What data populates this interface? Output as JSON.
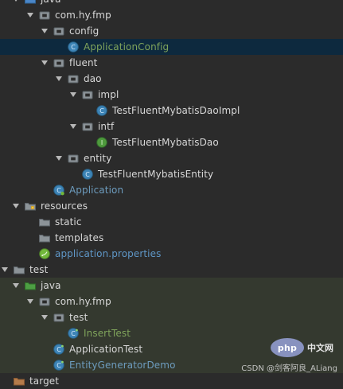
{
  "tree": [
    {
      "label": "java",
      "indent": 0,
      "expanded": true,
      "icon": "folder-source",
      "color": "white"
    },
    {
      "label": "com.hy.fmp",
      "indent": 1,
      "expanded": true,
      "icon": "package",
      "color": "white"
    },
    {
      "label": "config",
      "indent": 2,
      "expanded": true,
      "icon": "package",
      "color": "white"
    },
    {
      "label": "ApplicationConfig",
      "indent": 3,
      "expanded": false,
      "icon": "class",
      "color": "green",
      "selected": true
    },
    {
      "label": "fluent",
      "indent": 2,
      "expanded": true,
      "icon": "package",
      "color": "white"
    },
    {
      "label": "dao",
      "indent": 3,
      "expanded": true,
      "icon": "package",
      "color": "white"
    },
    {
      "label": "impl",
      "indent": 4,
      "expanded": true,
      "icon": "package",
      "color": "white"
    },
    {
      "label": "TestFluentMybatisDaoImpl",
      "indent": 5,
      "expanded": false,
      "icon": "class",
      "color": "white"
    },
    {
      "label": "intf",
      "indent": 4,
      "expanded": true,
      "icon": "package",
      "color": "white"
    },
    {
      "label": "TestFluentMybatisDao",
      "indent": 5,
      "expanded": false,
      "icon": "interface",
      "color": "white"
    },
    {
      "label": "entity",
      "indent": 3,
      "expanded": true,
      "icon": "package",
      "color": "white"
    },
    {
      "label": "TestFluentMybatisEntity",
      "indent": 4,
      "expanded": false,
      "icon": "class",
      "color": "white"
    },
    {
      "label": "Application",
      "indent": 2,
      "expanded": false,
      "icon": "spring-class",
      "color": "blue"
    },
    {
      "label": "resources",
      "indent": 0,
      "expanded": true,
      "icon": "resources-folder",
      "color": "white"
    },
    {
      "label": "static",
      "indent": 1,
      "expanded": false,
      "icon": "folder",
      "color": "white"
    },
    {
      "label": "templates",
      "indent": 1,
      "expanded": false,
      "icon": "folder",
      "color": "white"
    },
    {
      "label": "application.properties",
      "indent": 1,
      "expanded": false,
      "icon": "spring-props",
      "color": "blue2"
    },
    {
      "label": "test",
      "indent": -1,
      "expanded": true,
      "icon": "folder",
      "color": "white"
    },
    {
      "label": "java",
      "indent": 0,
      "expanded": true,
      "icon": "test-source-folder",
      "color": "white",
      "testZone": true
    },
    {
      "label": "com.hy.fmp",
      "indent": 1,
      "expanded": true,
      "icon": "package",
      "color": "white",
      "testZone": true
    },
    {
      "label": "test",
      "indent": 2,
      "expanded": true,
      "icon": "package",
      "color": "white",
      "testZone": true
    },
    {
      "label": "InsertTest",
      "indent": 3,
      "expanded": false,
      "icon": "class-test",
      "color": "green",
      "testZone": true
    },
    {
      "label": "ApplicationTest",
      "indent": 2,
      "expanded": false,
      "icon": "class-test",
      "color": "white",
      "testZone": true
    },
    {
      "label": "EntityGeneratorDemo",
      "indent": 2,
      "expanded": false,
      "icon": "class-test",
      "color": "blue",
      "testZone": true
    },
    {
      "label": "target",
      "indent": -1,
      "expanded": false,
      "icon": "folder-excluded",
      "color": "white"
    }
  ],
  "watermark": {
    "logo": "php",
    "cn": "中文网",
    "text": "CSDN @剑客阿良_ALiang"
  },
  "colors": {
    "background": "#2b2b2b",
    "selected": "#0d293e",
    "test_zone": "#34392f",
    "green_text": "#7fa35b",
    "blue_text": "#6d9cbe"
  }
}
